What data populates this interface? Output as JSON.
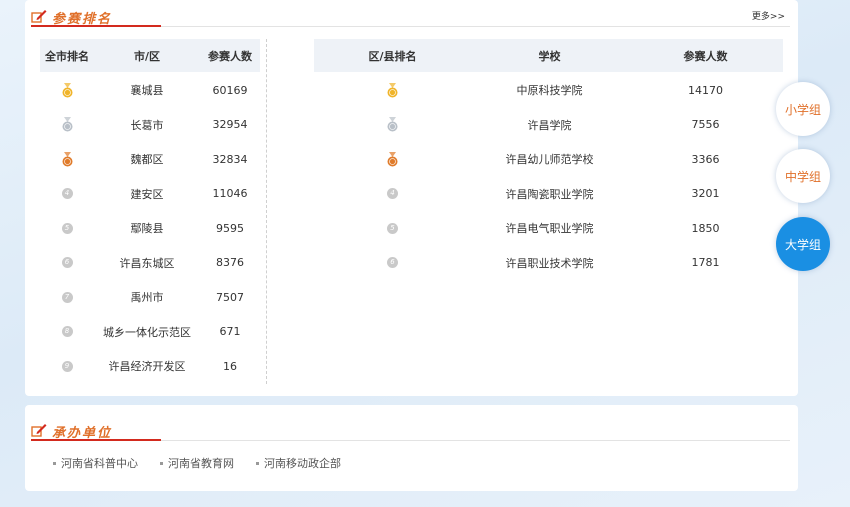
{
  "colors": {
    "accent": "#e0702a",
    "rule_red": "#d32a1e",
    "tab_active": "#1a8fe3",
    "gold": "#f0b429",
    "silver": "#b9c0c8",
    "bronze": "#e07b2a",
    "rank_grey": "#c9c9c9"
  },
  "ranking": {
    "title": "参赛排名",
    "more": "更多>>",
    "city_table": {
      "headers": [
        "全市排名",
        "市/区",
        "参赛人数"
      ],
      "rows": [
        {
          "rank": "1",
          "medal": "gold",
          "city": "襄城县",
          "count": "60169"
        },
        {
          "rank": "2",
          "medal": "silver",
          "city": "长葛市",
          "count": "32954"
        },
        {
          "rank": "3",
          "medal": "bronze",
          "city": "魏都区",
          "count": "32834"
        },
        {
          "rank": "4",
          "medal": "",
          "city": "建安区",
          "count": "11046"
        },
        {
          "rank": "5",
          "medal": "",
          "city": "鄢陵县",
          "count": "9595"
        },
        {
          "rank": "6",
          "medal": "",
          "city": "许昌东城区",
          "count": "8376"
        },
        {
          "rank": "7",
          "medal": "",
          "city": "禹州市",
          "count": "7507"
        },
        {
          "rank": "8",
          "medal": "",
          "city": "城乡一体化示范区",
          "count": "671"
        },
        {
          "rank": "9",
          "medal": "",
          "city": "许昌经济开发区",
          "count": "16"
        }
      ]
    },
    "school_table": {
      "headers": [
        "区/县排名",
        "学校",
        "参赛人数"
      ],
      "rows": [
        {
          "rank": "1",
          "medal": "gold",
          "school": "中原科技学院",
          "count": "14170"
        },
        {
          "rank": "2",
          "medal": "silver",
          "school": "许昌学院",
          "count": "7556"
        },
        {
          "rank": "3",
          "medal": "bronze",
          "school": "许昌幼儿师范学校",
          "count": "3366"
        },
        {
          "rank": "4",
          "medal": "",
          "school": "许昌陶瓷职业学院",
          "count": "3201"
        },
        {
          "rank": "5",
          "medal": "",
          "school": "许昌电气职业学院",
          "count": "1850"
        },
        {
          "rank": "6",
          "medal": "",
          "school": "许昌职业技术学院",
          "count": "1781"
        }
      ]
    }
  },
  "group_tabs": [
    {
      "label": "小学组",
      "active": false
    },
    {
      "label": "中学组",
      "active": false
    },
    {
      "label": "大学组",
      "active": true
    }
  ],
  "organizers": {
    "title": "承办单位",
    "items": [
      "河南省科普中心",
      "河南省教育网",
      "河南移动政企部"
    ]
  }
}
